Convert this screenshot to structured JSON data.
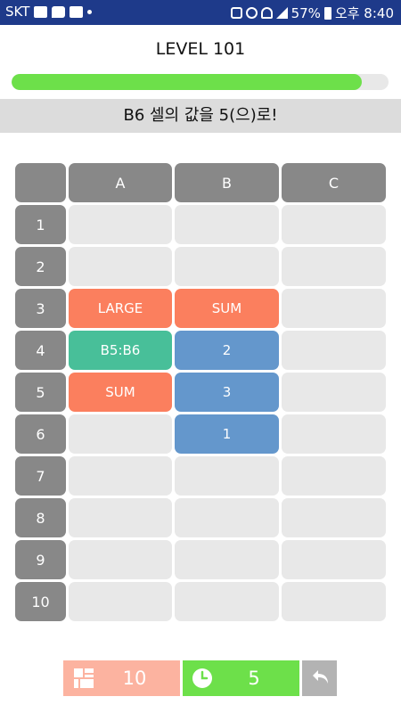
{
  "status_bar": {
    "carrier": "SKT",
    "battery": "57%",
    "time": "오후 8:40",
    "bg_color": "#1e3a8a"
  },
  "level": {
    "title": "LEVEL 101",
    "progress_fraction": 0.93,
    "progress_color": "#6de04a"
  },
  "mission": {
    "text": "B6 셀의 값을 5(으)로!"
  },
  "grid": {
    "column_headers": [
      "A",
      "B",
      "C"
    ],
    "row_headers": [
      "1",
      "2",
      "3",
      "4",
      "5",
      "6",
      "7",
      "8",
      "9",
      "10"
    ],
    "cells": [
      [
        "",
        "",
        ""
      ],
      [
        "",
        "",
        ""
      ],
      [
        "LARGE",
        "SUM",
        ""
      ],
      [
        "B5:B6",
        "2",
        ""
      ],
      [
        "SUM",
        "3",
        ""
      ],
      [
        "",
        "1",
        ""
      ],
      [
        "",
        "",
        ""
      ],
      [
        "",
        "",
        ""
      ],
      [
        "",
        "",
        ""
      ],
      [
        "",
        "",
        ""
      ]
    ],
    "cell_colors": [
      [
        "empty",
        "empty",
        "empty"
      ],
      [
        "empty",
        "empty",
        "empty"
      ],
      [
        "orange",
        "orange",
        "empty"
      ],
      [
        "green",
        "blue",
        "empty"
      ],
      [
        "orange",
        "blue",
        "empty"
      ],
      [
        "empty",
        "blue",
        "empty"
      ],
      [
        "empty",
        "empty",
        "empty"
      ],
      [
        "empty",
        "empty",
        "empty"
      ],
      [
        "empty",
        "empty",
        "empty"
      ],
      [
        "empty",
        "empty",
        "empty"
      ]
    ],
    "colors": {
      "header": "#888888",
      "empty": "#e8e8e8",
      "orange": "#fb7f5e",
      "green": "#48bf99",
      "blue": "#6497cc"
    }
  },
  "footer": {
    "cells_icon": "grid-icon",
    "cells_count": "10",
    "timer_icon": "clock-icon",
    "timer_value": "5",
    "undo_icon": "undo-icon"
  }
}
